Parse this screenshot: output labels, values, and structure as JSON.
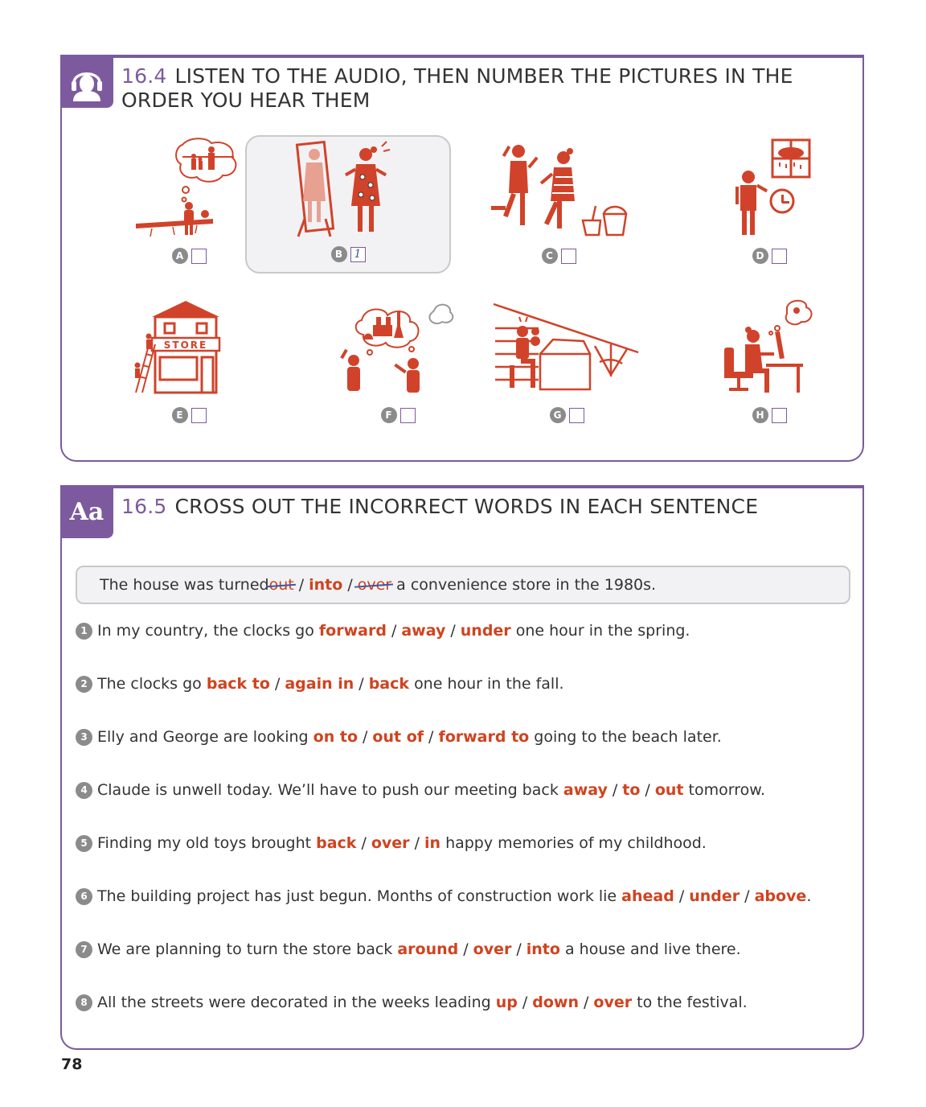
{
  "exercise1": {
    "number": "16.4",
    "title": "LISTEN TO THE AUDIO, THEN NUMBER THE PICTURES IN THE ORDER YOU HEAR THEM",
    "icon": "headphones-person-icon",
    "pictures": [
      {
        "letter": "A",
        "answer": "",
        "icon": "person-remembering-family-icon"
      },
      {
        "letter": "B",
        "answer": "1",
        "icon": "girl-mirror-dress-icon",
        "selected": true
      },
      {
        "letter": "C",
        "answer": "",
        "icon": "children-beach-icon"
      },
      {
        "letter": "D",
        "answer": "",
        "icon": "rain-window-clock-icon"
      },
      {
        "letter": "E",
        "answer": "",
        "icon": "store-building-icon"
      },
      {
        "letter": "F",
        "answer": "",
        "icon": "people-dreaming-city-icon"
      },
      {
        "letter": "G",
        "answer": "",
        "icon": "attic-toys-icon"
      },
      {
        "letter": "H",
        "answer": "",
        "icon": "woman-computer-icon"
      }
    ],
    "store_sign": "STORE"
  },
  "exercise2": {
    "number": "16.5",
    "title": "CROSS OUT THE INCORRECT WORDS IN EACH SENTENCE",
    "tab_label": "Aa",
    "example": {
      "before": "The house was turned",
      "options": [
        "out",
        "into",
        "over"
      ],
      "struck": [
        true,
        false,
        true
      ],
      "after": "a convenience store in the 1980s."
    },
    "sentences": [
      {
        "n": "1",
        "before": "In my country, the clocks go",
        "options": [
          "forward",
          "away",
          "under"
        ],
        "after": "one hour in the spring."
      },
      {
        "n": "2",
        "before": "The clocks go",
        "options": [
          "back to",
          "again in",
          "back"
        ],
        "after": "one hour in the fall."
      },
      {
        "n": "3",
        "before": "Elly and George are looking",
        "options": [
          "on to",
          "out of",
          "forward to"
        ],
        "after": "going to the beach later."
      },
      {
        "n": "4",
        "before": "Claude is unwell today. We’ll have to push our meeting back",
        "options": [
          "away",
          "to",
          "out"
        ],
        "after": "tomorrow."
      },
      {
        "n": "5",
        "before": "Finding my old toys brought",
        "options": [
          "back",
          "over",
          "in"
        ],
        "after": "happy memories of my childhood."
      },
      {
        "n": "6",
        "before": "The building project has just begun. Months of construction work lie",
        "options": [
          "ahead",
          "under",
          "above"
        ],
        "after": "."
      },
      {
        "n": "7",
        "before": "We are planning to turn the store back",
        "options": [
          "around",
          "over",
          "into"
        ],
        "after": "a house and live there."
      },
      {
        "n": "8",
        "before": "All the streets were decorated in the weeks leading",
        "options": [
          "up",
          "down",
          "over"
        ],
        "after": "to the festival."
      }
    ]
  },
  "page_number": "78",
  "colors": {
    "accent": "#7d5a9e",
    "option": "#d0431f",
    "illustration": "#d0432a",
    "strike": "#3a57a8"
  }
}
